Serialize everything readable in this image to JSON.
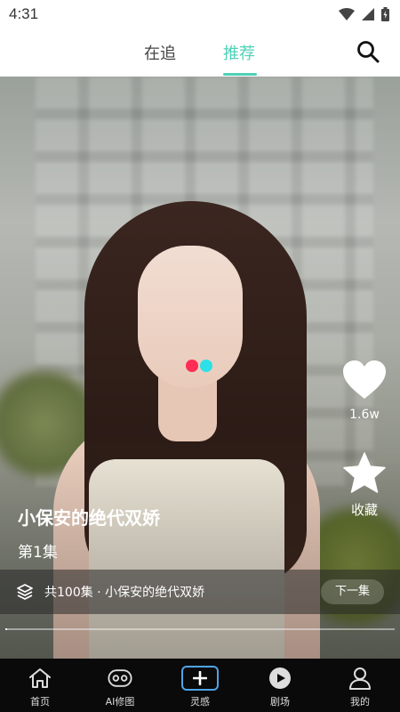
{
  "status_bar": {
    "time": "4:31"
  },
  "top_nav": {
    "tabs": [
      {
        "label": "在追"
      },
      {
        "label": "推荐",
        "active": true
      }
    ],
    "accent_color": "#4fd1b9"
  },
  "video": {
    "like_count": "1.6w",
    "favorite_label": "收藏",
    "drama_title": "小保安的绝代双娇",
    "episode": "第1集",
    "series_info": "共100集 · 小保安的绝代双娇",
    "next_button": "下一集",
    "progress": 0.005
  },
  "bottom_nav": {
    "items": [
      {
        "label": "首页",
        "icon": "home-icon"
      },
      {
        "label": "AI修图",
        "icon": "gamepad-icon"
      },
      {
        "label": "灵感",
        "icon": "plus-icon",
        "active": true
      },
      {
        "label": "剧场",
        "icon": "play-circle-icon"
      },
      {
        "label": "我的",
        "icon": "user-icon"
      }
    ]
  }
}
